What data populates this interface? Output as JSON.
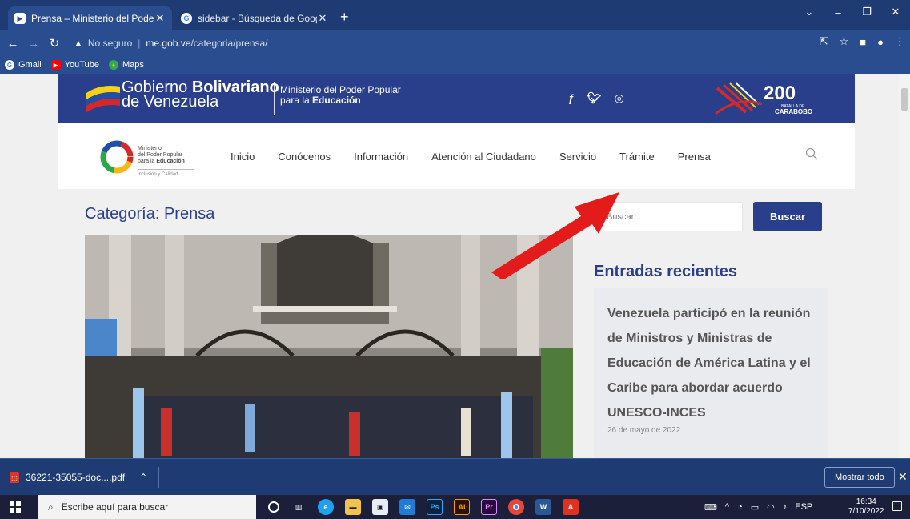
{
  "browser": {
    "tabs": [
      {
        "title": "Prensa – Ministerio del Poder Po",
        "active": true
      },
      {
        "title": "sidebar - Búsqueda de Google",
        "active": false
      }
    ],
    "new_tab": "+",
    "window_controls": [
      "⌄",
      "–",
      "❐",
      "✕"
    ],
    "security_label": "No seguro",
    "url_host": "me.gob.ve",
    "url_path": "/categoria/prensa/",
    "bookmarks": [
      {
        "label": "Gmail",
        "icon": "google-icon"
      },
      {
        "label": "YouTube",
        "icon": "youtube-icon"
      },
      {
        "label": "Maps",
        "icon": "maps-icon"
      }
    ]
  },
  "gob_bar": {
    "line1_regular": "Gobierno ",
    "line1_bold": "Bolivariano",
    "line2": "de Venezuela",
    "ministry_line1": "Ministerio del Poder Popular",
    "ministry_line2_regular": "para la ",
    "ministry_line2_bold": "Educación",
    "social_icons": [
      "facebook-icon",
      "twitter-icon",
      "instagram-icon"
    ],
    "bicentenario_number": "200",
    "bicentenario_line1": "BATALLA DE",
    "bicentenario_line2": "CARABOBO"
  },
  "site_header": {
    "logo_line1": "Ministerio",
    "logo_line2": "del Poder Popular",
    "logo_line3_regular": "para la ",
    "logo_line3_bold": "Educación",
    "logo_tagline": "Inclusión y Calidad",
    "nav": [
      "Inicio",
      "Conócenos",
      "Información",
      "Atención al Ciudadano",
      "Servicio",
      "Trámite",
      "Prensa"
    ]
  },
  "main": {
    "category_title": "Categoría: Prensa",
    "search_placeholder": "Buscar...",
    "search_button": "Buscar",
    "recent_title": "Entradas recientes",
    "recent_post_title": "Venezuela participó en la reunión de Ministros y Ministras de Educación de América Latina y el Caribe para abordar acuerdo UNESCO-INCES",
    "recent_post_date": "26 de mayo de 2022"
  },
  "download_bar": {
    "file_name": "36221-35055-doc....pdf",
    "show_all": "Mostrar todo",
    "close": "✕"
  },
  "taskbar": {
    "search_placeholder": "Escribe aquí para buscar",
    "language": "ESP",
    "time": "16:34",
    "date": "7/10/2022",
    "apps": [
      "cortana-icon",
      "task-view-icon",
      "edge-icon",
      "file-explorer-icon",
      "store-icon",
      "mail-icon",
      "photoshop-icon",
      "illustrator-icon",
      "premiere-icon",
      "chrome-icon",
      "word-icon",
      "acrobat-icon"
    ]
  },
  "colors": {
    "chrome_dark": "#1f3b73",
    "chrome": "#2a4d8f",
    "gob_blue": "#2a3f8c",
    "arrow_red": "#e31b1b"
  }
}
